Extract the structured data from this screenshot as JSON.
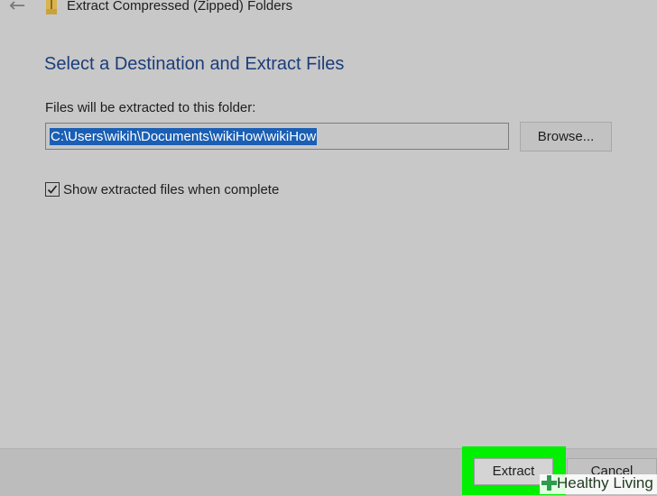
{
  "window": {
    "title": "Extract Compressed (Zipped) Folders"
  },
  "dialog": {
    "heading": "Select a Destination and Extract Files",
    "folder_label": "Files will be extracted to this folder:",
    "path_value": "C:\\Users\\wikih\\Documents\\wikiHow\\wikiHow",
    "browse_label": "Browse...",
    "show_files_label": "Show extracted files when complete",
    "show_files_checked": true
  },
  "footer": {
    "extract_label": "Extract",
    "cancel_label": "Cancel"
  },
  "watermark": {
    "text": "Healthy Living"
  },
  "icons": {
    "back": "back-arrow-icon",
    "folder": "zip-folder-icon",
    "check": "checkmark-icon",
    "watermark": "plus-icon"
  },
  "colors": {
    "heading": "#1c3d7a",
    "selection": "#1a5fb4",
    "highlight": "#00f000",
    "background": "#c8c8c8"
  }
}
